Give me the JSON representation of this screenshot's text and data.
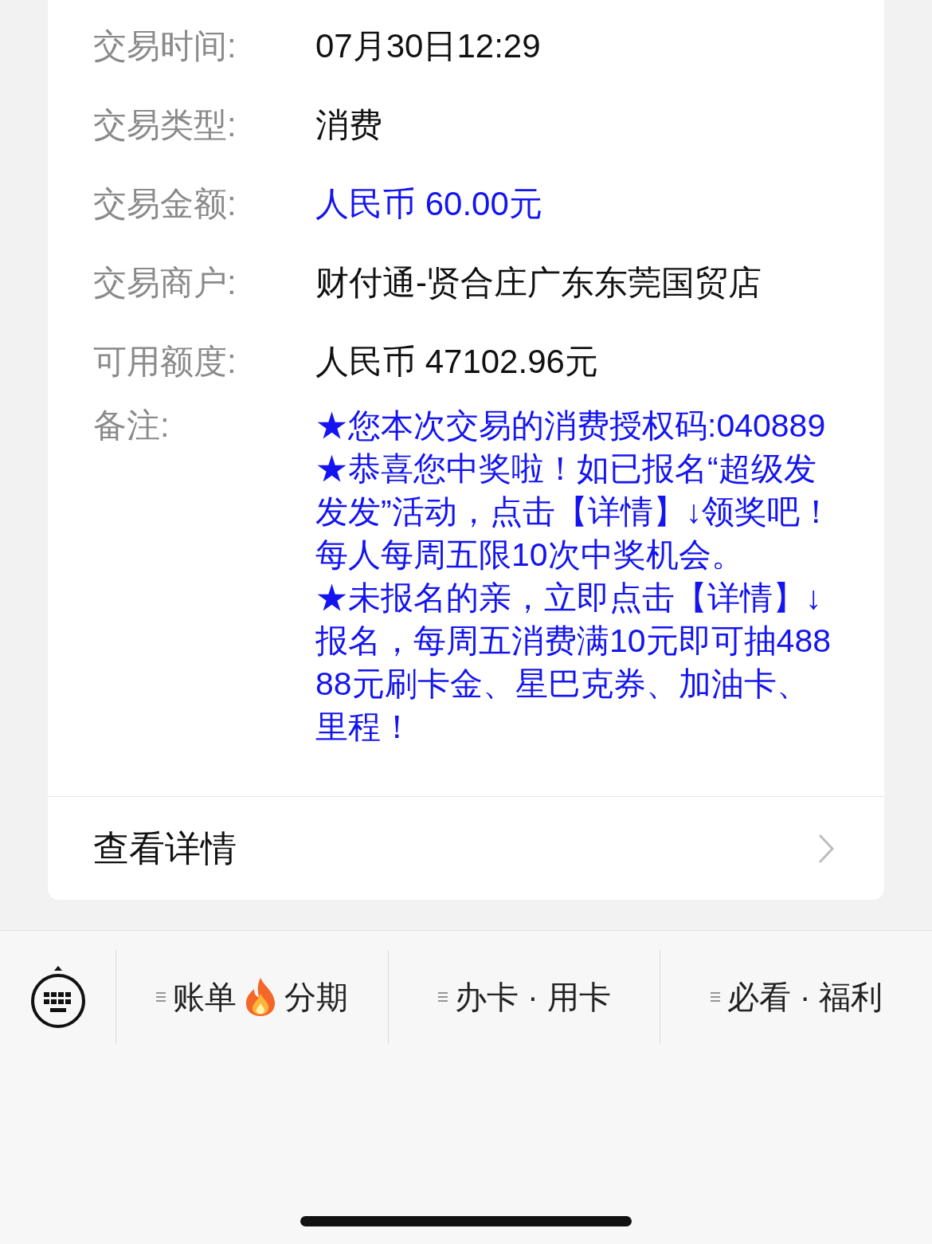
{
  "fields": [
    {
      "label": "交易时间:",
      "value": "07月30日12:29",
      "kind": "plain"
    },
    {
      "label": "交易类型:",
      "value": "消费",
      "kind": "plain"
    },
    {
      "label": "交易金额:",
      "value": "人民币 60.00元",
      "kind": "highlight"
    },
    {
      "label": "交易商户:",
      "value": "财付通-贤合庄广东东莞国贸店",
      "kind": "plain"
    },
    {
      "label": "可用额度:",
      "value": "人民币 47102.96元",
      "kind": "plain"
    }
  ],
  "remarks": {
    "label": "备注:",
    "paragraphs": [
      "★您本次交易的消费授权码:040889",
      "★恭喜您中奖啦！如已报名“超级发发发”活动，点击【详情】↓领奖吧！每人每周五限10次中奖机会。",
      "★未报名的亲，立即点击【详情】↓报名，每周五消费满10元即可抽48888元刷卡金、星巴克券、加油卡、里程！"
    ]
  },
  "details_link": "查看详情",
  "menu": [
    {
      "parts": [
        "账单",
        "分期"
      ]
    },
    {
      "parts": [
        "办卡 · 用卡"
      ]
    },
    {
      "parts": [
        "必看 · 福利"
      ]
    }
  ]
}
